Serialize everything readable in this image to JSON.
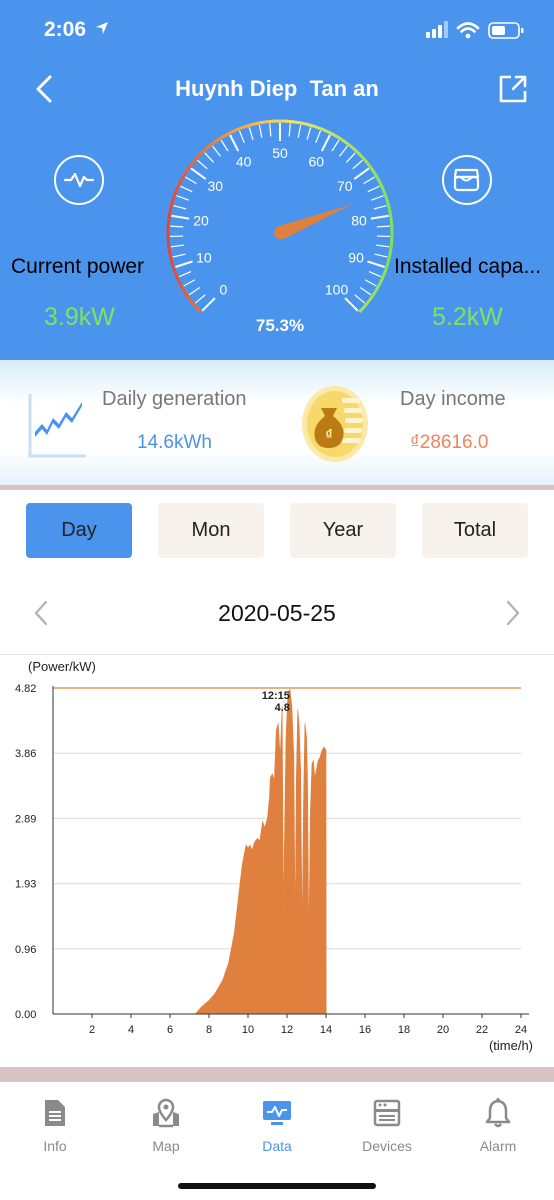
{
  "status_bar": {
    "time": "2:06"
  },
  "header": {
    "title": "Huynh Diep  Tan an"
  },
  "gauge": {
    "tick_labels": [
      "0",
      "10",
      "20",
      "30",
      "40",
      "50",
      "60",
      "70",
      "80",
      "90",
      "100"
    ],
    "percent_text": "75.3%",
    "needle_percent": 75.3
  },
  "current_power": {
    "label": "Current power",
    "value": "3.9kW"
  },
  "installed_capacity": {
    "label": "Installed capa...",
    "value": "5.2kW"
  },
  "summary": {
    "daily_generation_label": "Daily generation",
    "daily_generation_value": "14.6kWh",
    "day_income_label": "Day income",
    "day_income_value": "₫28616.0"
  },
  "period_tabs": {
    "day": "Day",
    "mon": "Mon",
    "year": "Year",
    "total": "Total",
    "active": "day"
  },
  "date_nav": {
    "date": "2020-05-25"
  },
  "chart_data": {
    "type": "area",
    "ylabel": "(Power/kW)",
    "xlabel": "(time/h)",
    "y_ticks": [
      "0.00",
      "0.96",
      "1.93",
      "2.89",
      "3.86",
      "4.82"
    ],
    "x_ticks": [
      "2",
      "4",
      "6",
      "8",
      "10",
      "12",
      "14",
      "16",
      "18",
      "20",
      "22",
      "24"
    ],
    "xlim": [
      0,
      24
    ],
    "ylim": [
      0,
      4.82
    ],
    "max_line": 4.82,
    "peak_annotation": {
      "time": "12:15",
      "value": "4.8"
    },
    "color": "#e0803f",
    "x": [
      7.3,
      7.6,
      8.0,
      8.3,
      8.7,
      9.0,
      9.3,
      9.5,
      9.7,
      9.9,
      10.0,
      10.1,
      10.2,
      10.35,
      10.5,
      10.6,
      10.75,
      10.85,
      11.0,
      11.1,
      11.15,
      11.25,
      11.35,
      11.45,
      11.55,
      11.65,
      11.75,
      11.82,
      11.9,
      11.95,
      12.05,
      12.15,
      12.25,
      12.35,
      12.42,
      12.48,
      12.55,
      12.62,
      12.7,
      12.78,
      12.85,
      12.92,
      13.0,
      13.05,
      13.12,
      13.2,
      13.28,
      13.35,
      13.42,
      13.5,
      13.6,
      13.7,
      13.8,
      13.9,
      14.0,
      14.01
    ],
    "y": [
      0.0,
      0.1,
      0.2,
      0.3,
      0.5,
      0.75,
      1.2,
      1.7,
      2.2,
      2.5,
      2.45,
      2.5,
      2.42,
      2.55,
      2.6,
      2.55,
      2.85,
      2.75,
      2.9,
      3.2,
      3.5,
      3.55,
      3.45,
      4.2,
      4.3,
      3.8,
      4.55,
      1.5,
      3.2,
      4.1,
      4.75,
      4.8,
      4.55,
      3.8,
      1.3,
      3.5,
      4.5,
      4.3,
      3.6,
      1.2,
      3.2,
      4.3,
      4.1,
      3.5,
      1.1,
      3.0,
      3.7,
      3.75,
      3.5,
      3.6,
      3.75,
      3.8,
      3.9,
      3.95,
      3.9,
      0.0
    ]
  },
  "tabbar": {
    "info": "Info",
    "map": "Map",
    "data": "Data",
    "devices": "Devices",
    "alarm": "Alarm",
    "active": "data"
  },
  "colors": {
    "header_blue": "#4a94ee",
    "value_green": "#7ee35e",
    "income_orange": "#f0825d",
    "chart_orange": "#e0803f",
    "tab_inactive_bg": "#f7f2ec"
  }
}
